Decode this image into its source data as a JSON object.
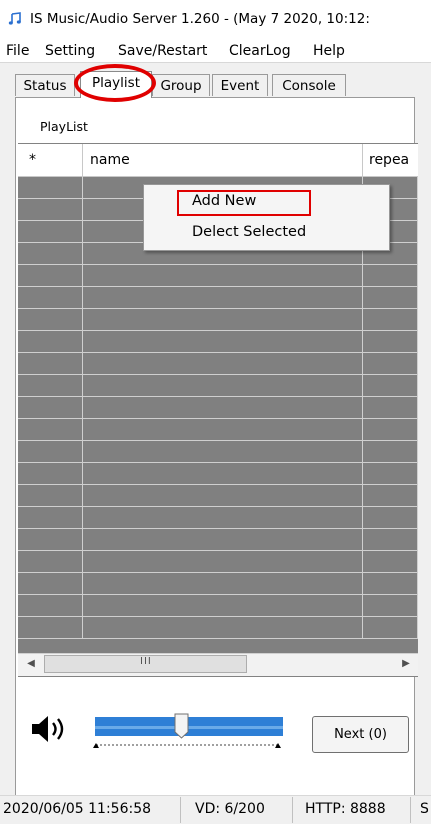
{
  "window": {
    "title": "IS Music/Audio Server 1.260 - (May  7 2020, 10:12:"
  },
  "menu": [
    "File",
    "Setting",
    "Save/Restart",
    "ClearLog",
    "Help"
  ],
  "tabs": [
    {
      "label": "Status",
      "active": false
    },
    {
      "label": "Playlist",
      "active": true
    },
    {
      "label": "Group",
      "active": false
    },
    {
      "label": "Event",
      "active": false
    },
    {
      "label": "Console",
      "active": false
    }
  ],
  "playlist": {
    "section_label": "PlayList",
    "columns": [
      "*",
      "name",
      "repea"
    ],
    "row_count": 21
  },
  "context_menu": {
    "items": [
      "Add New",
      "Delect Selected"
    ]
  },
  "scrollbar": {
    "grip": "III"
  },
  "volume": {
    "icon": "speaker-icon",
    "level": 0.46
  },
  "next_button": {
    "label": "Next (0)"
  },
  "status_bar": {
    "datetime": "2020/06/05 11:56:58",
    "vd": "VD: 6/200",
    "http": "HTTP: 8888",
    "extra": "S"
  },
  "colors": {
    "highlight_red": "#e00000",
    "slider_blue": "#2e7fd6",
    "grid_gray": "#808080"
  }
}
